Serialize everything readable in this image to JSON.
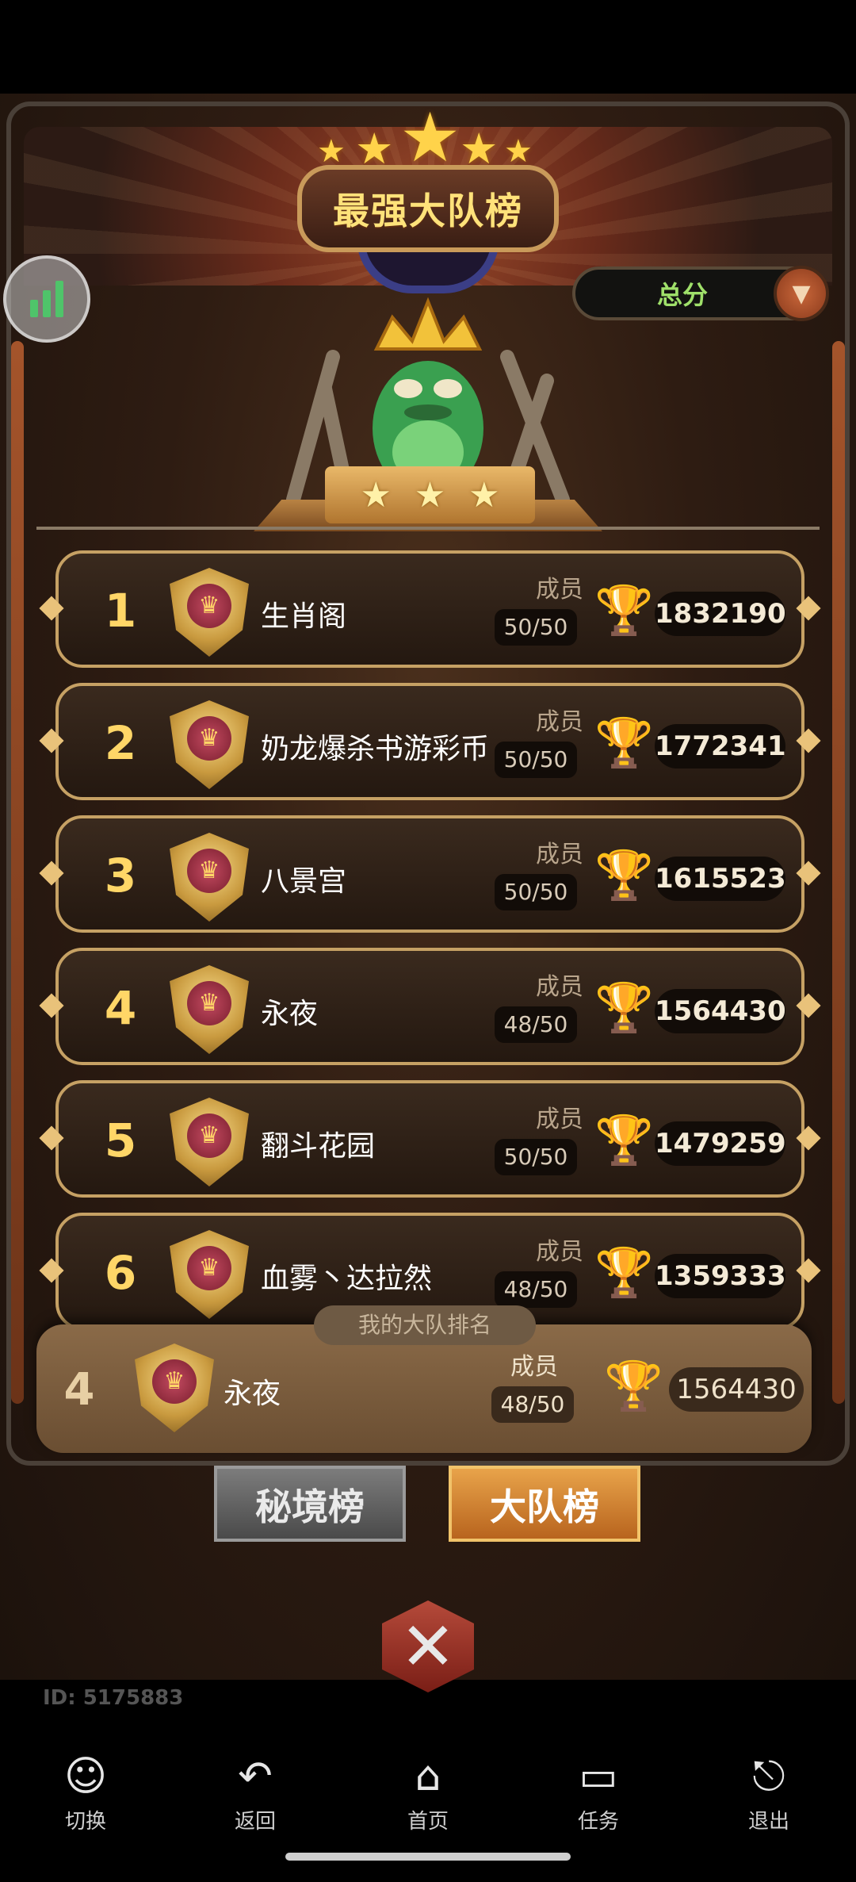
{
  "header": {
    "title": "最强大队榜",
    "filter_value": "总分"
  },
  "teams": [
    {
      "rank": "1",
      "name": "生肖阁",
      "members_label": "成员",
      "members": "50/50",
      "score": "1832190"
    },
    {
      "rank": "2",
      "name": "奶龙爆杀书游彩币",
      "members_label": "成员",
      "members": "50/50",
      "score": "1772341"
    },
    {
      "rank": "3",
      "name": "八景宫",
      "members_label": "成员",
      "members": "50/50",
      "score": "1615523"
    },
    {
      "rank": "4",
      "name": "永夜",
      "members_label": "成员",
      "members": "48/50",
      "score": "1564430"
    },
    {
      "rank": "5",
      "name": "翻斗花园",
      "members_label": "成员",
      "members": "50/50",
      "score": "1479259"
    },
    {
      "rank": "6",
      "name": "血雾丶达拉然",
      "members_label": "成员",
      "members": "48/50",
      "score": "1359333"
    }
  ],
  "my_team": {
    "tag": "我的大队排名",
    "rank": "4",
    "name": "永夜",
    "members_label": "成员",
    "members": "48/50",
    "score": "1564430"
  },
  "tabs": {
    "secret": "秘境榜",
    "team": "大队榜"
  },
  "user_id": "ID: 5175883",
  "navbar": [
    {
      "label": "切换",
      "icon": "switch-icon"
    },
    {
      "label": "返回",
      "icon": "back-icon"
    },
    {
      "label": "首页",
      "icon": "home-icon"
    },
    {
      "label": "任务",
      "icon": "task-icon"
    },
    {
      "label": "退出",
      "icon": "exit-icon"
    }
  ],
  "colors": {
    "gold": "#ffd667",
    "filter_text": "#9fe06a",
    "active_tab": "#e8a34a"
  }
}
